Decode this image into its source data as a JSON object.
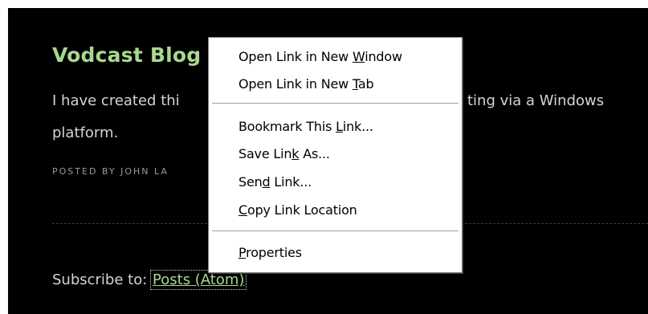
{
  "post": {
    "title": "Vodcast Blog",
    "body_line1": "I have created thi",
    "body_line1_tail": "ting via a Windows",
    "body_line2": "platform.",
    "meta": "POSTED BY JOHN LA"
  },
  "subscribe": {
    "label": "Subscribe to:",
    "link": "Posts (Atom)"
  },
  "context_menu": {
    "items": [
      {
        "pre": "Open Link in New ",
        "key": "W",
        "post": "indow"
      },
      {
        "pre": "Open Link in New ",
        "key": "T",
        "post": "ab"
      },
      {
        "pre": "Bookmark This ",
        "key": "L",
        "post": "ink..."
      },
      {
        "pre": "Save Lin",
        "key": "k",
        "post": " As..."
      },
      {
        "pre": "Sen",
        "key": "d",
        "post": " Link..."
      },
      {
        "pre": "",
        "key": "C",
        "post": "opy Link Location"
      },
      {
        "pre": "",
        "key": "P",
        "post": "roperties"
      }
    ]
  }
}
